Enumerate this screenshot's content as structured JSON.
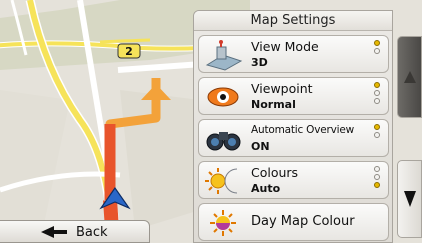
{
  "panel": {
    "title": "Map Settings",
    "items": [
      {
        "label": "View Mode",
        "value": "3D",
        "icon": "view-mode-icon",
        "options": 2,
        "selected": 0
      },
      {
        "label": "Viewpoint",
        "value": "Normal",
        "icon": "viewpoint-eye-icon",
        "options": 3,
        "selected": 0
      },
      {
        "label": "Automatic Overview",
        "value": "ON",
        "icon": "binoculars-icon",
        "options": 2,
        "selected": 0
      },
      {
        "label": "Colours",
        "value": "Auto",
        "icon": "sun-moon-icon",
        "options": 3,
        "selected": 2
      },
      {
        "label": "Day Map Colour",
        "icon": "sun-palette-icon"
      }
    ]
  },
  "map": {
    "road_label": "2"
  },
  "nav": {
    "back_label": "Back"
  },
  "colors": {
    "route": "#f3a23a",
    "road_yellow": "#f6e35a",
    "position_arrow": "#2a67c8"
  }
}
